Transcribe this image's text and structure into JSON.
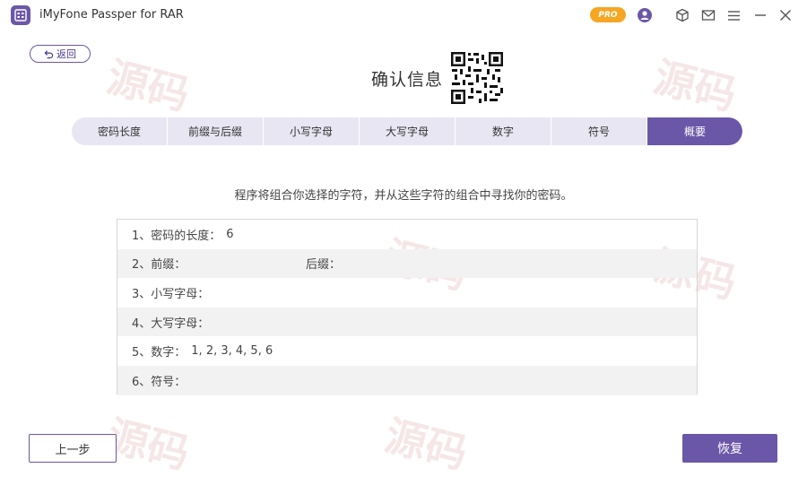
{
  "titlebar": {
    "app_title": "iMyFone Passper for RAR",
    "pro_badge": "PRO",
    "icons": [
      "user-icon",
      "box-icon",
      "mail-icon",
      "menu-icon",
      "minimize-icon",
      "close-icon"
    ]
  },
  "back": {
    "label": "返回"
  },
  "header": {
    "title": "确认信息"
  },
  "tabs": [
    {
      "label": "密码长度",
      "active": false
    },
    {
      "label": "前缀与后缀",
      "active": false
    },
    {
      "label": "小写字母",
      "active": false
    },
    {
      "label": "大写字母",
      "active": false
    },
    {
      "label": "数字",
      "active": false
    },
    {
      "label": "符号",
      "active": false
    },
    {
      "label": "概要",
      "active": true
    }
  ],
  "description": "程序将组合你选择的字符，并从这些字符的组合中寻找你的密码。",
  "summary": {
    "rows": [
      {
        "label": "1、密码的长度：",
        "value": "6"
      },
      {
        "label": "2、前缀：",
        "value": "",
        "suffix_label": "后缀："
      },
      {
        "label": "3、小写字母：",
        "value": ""
      },
      {
        "label": "4、大写字母：",
        "value": ""
      },
      {
        "label": "5、数字：",
        "value": "1, 2, 3, 4, 5, 6"
      },
      {
        "label": "6、符号：",
        "value": ""
      }
    ]
  },
  "footer": {
    "prev_label": "上一步",
    "recover_label": "恢复"
  },
  "colors": {
    "accent": "#6b57a8",
    "tab_bg": "#e9e6f3",
    "pro_badge": "#f5a623"
  }
}
